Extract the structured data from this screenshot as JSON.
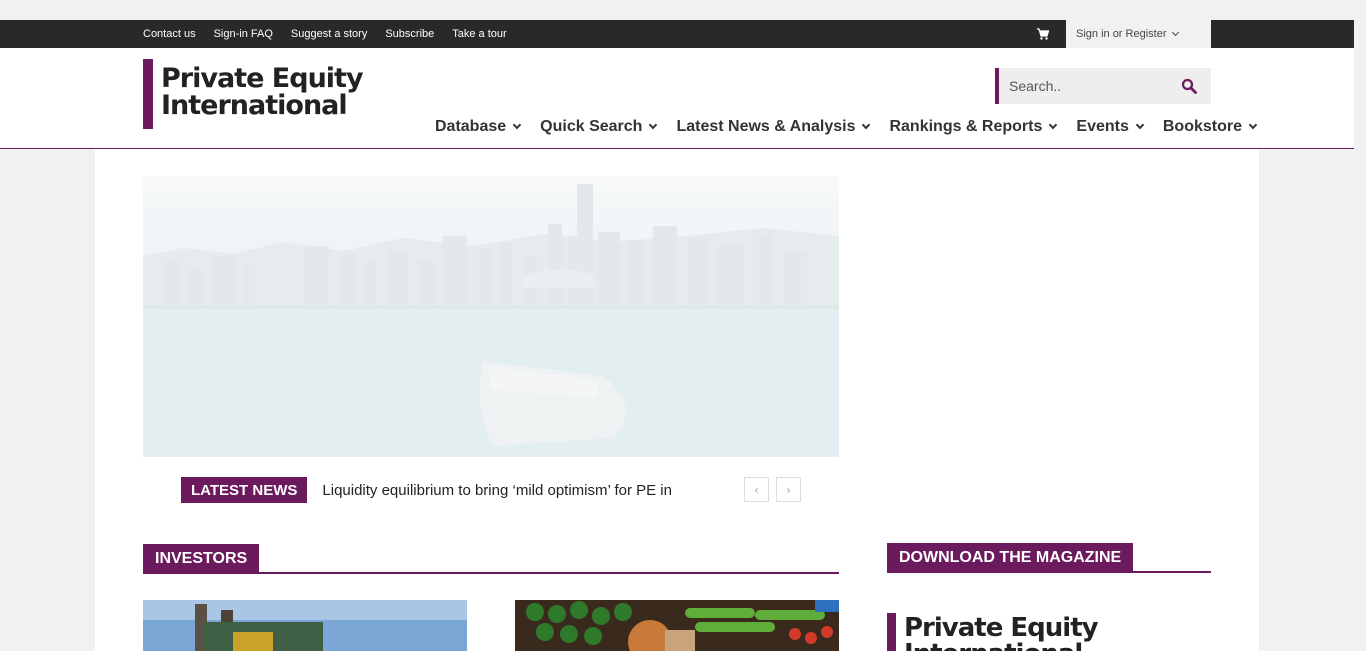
{
  "topbar": {
    "links": [
      "Contact us",
      "Sign-in FAQ",
      "Suggest a story",
      "Subscribe",
      "Take a tour"
    ],
    "signin_label": "Sign in or Register"
  },
  "header": {
    "logo_line1": "Private Equity",
    "logo_line2": "International",
    "search_placeholder": "Search..",
    "nav": [
      "Database",
      "Quick Search",
      "Latest News & Analysis",
      "Rankings & Reports",
      "Events",
      "Bookstore"
    ]
  },
  "ticker": {
    "tag": "LATEST NEWS",
    "headline": "Liquidity equilibrium to bring ‘mild optimism’ for PE in"
  },
  "sections": {
    "investors": "INVESTORS",
    "magazine": "DOWNLOAD THE MAGAZINE"
  },
  "colors": {
    "brand": "#6b1a5e",
    "topbar": "#2b2928"
  }
}
